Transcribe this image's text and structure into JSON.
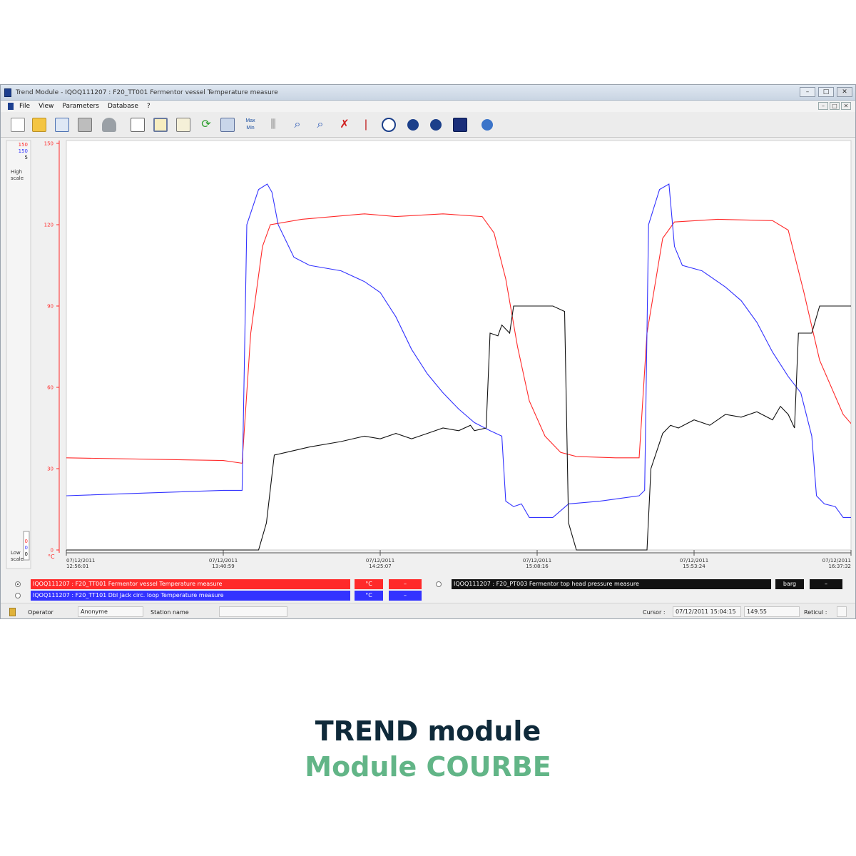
{
  "window": {
    "title": "Trend Module - IQOQ111207 : F20_TT001 Fermentor vessel Temperature measure",
    "min": "–",
    "max": "□",
    "close": "✕"
  },
  "menu": {
    "items": [
      "File",
      "View",
      "Parameters",
      "Database",
      "?"
    ],
    "mdi_min": "–",
    "mdi_max": "□",
    "mdi_close": "✕"
  },
  "toolbar": {
    "max_label": "Max",
    "min_label": "Min",
    "icons": [
      "new-file-icon",
      "open-folder-icon",
      "edit-icon",
      "print-icon",
      "export-icon",
      "report-icon",
      "window-icon",
      "chart-icon",
      "refresh-icon",
      "database-icon",
      "max-min-icon",
      "grid-icon",
      "zoom-in-icon",
      "zoom-out-icon",
      "zoom-reset-icon",
      "cursor-line-icon",
      "clock-icon",
      "previous-icon",
      "next-icon",
      "copy-windows-icon",
      "help-icon"
    ]
  },
  "colors": {
    "series_red": "#ff2a2a",
    "series_blue": "#3333ff",
    "series_black": "#111111",
    "caption_dark": "#0f2a3a",
    "caption_green": "#62b587"
  },
  "scale": {
    "high_values": [
      "150",
      "150",
      "5"
    ],
    "high_label_1": "High",
    "high_label_2": "scale",
    "low_values": [
      "0",
      "0",
      "0"
    ],
    "low_label_1": "Low",
    "low_label_2": "scale",
    "unit": "°C"
  },
  "chart_data": {
    "type": "line",
    "ylim": [
      0,
      150
    ],
    "y_ticks": [
      "150",
      "120",
      "90",
      "60",
      "30",
      "0"
    ],
    "x_ticks": [
      {
        "date": "07/12/2011",
        "time": "12:56:01"
      },
      {
        "date": "07/12/2011",
        "time": "13:40:59"
      },
      {
        "date": "07/12/2011",
        "time": "14:25:07"
      },
      {
        "date": "07/12/2011",
        "time": "15:08:16"
      },
      {
        "date": "07/12/2011",
        "time": "15:53:24"
      },
      {
        "date": "07/12/2011",
        "time": "16:37:32"
      }
    ],
    "x_range": [
      0,
      100
    ],
    "series": [
      {
        "name": "IQOQ111207 : F20_TT001 Fermentor vessel Temperature measure",
        "color": "#ff2a2a",
        "points": [
          [
            0,
            34
          ],
          [
            10,
            33.5
          ],
          [
            20,
            33
          ],
          [
            22.4,
            32
          ],
          [
            23.5,
            80
          ],
          [
            25,
            112
          ],
          [
            26,
            120
          ],
          [
            30,
            122
          ],
          [
            38,
            124
          ],
          [
            42,
            123
          ],
          [
            48,
            124
          ],
          [
            53,
            123
          ],
          [
            54.5,
            117
          ],
          [
            56,
            100
          ],
          [
            57.5,
            75
          ],
          [
            59,
            55
          ],
          [
            61,
            42
          ],
          [
            63,
            36
          ],
          [
            65,
            34.5
          ],
          [
            70,
            34
          ],
          [
            73,
            34
          ],
          [
            74,
            80
          ],
          [
            76,
            115
          ],
          [
            77.5,
            121
          ],
          [
            83,
            122
          ],
          [
            90,
            121.5
          ],
          [
            92,
            118
          ],
          [
            94,
            95
          ],
          [
            96,
            70
          ],
          [
            99,
            50
          ],
          [
            102,
            40
          ],
          [
            104,
            37
          ],
          [
            106,
            36
          ],
          [
            108,
            37
          ],
          [
            111,
            37
          ],
          [
            112,
            36
          ]
        ]
      },
      {
        "name": "IQOQ111207 : F20_TT101 Dbl Jack circ. loop Temperature measure",
        "color": "#3333ff",
        "points": [
          [
            0,
            20
          ],
          [
            10,
            21
          ],
          [
            20,
            22
          ],
          [
            22.4,
            22
          ],
          [
            23,
            120
          ],
          [
            24.5,
            133
          ],
          [
            25.6,
            135
          ],
          [
            26.2,
            132
          ],
          [
            27,
            120
          ],
          [
            29,
            108
          ],
          [
            31,
            105
          ],
          [
            35,
            103
          ],
          [
            38,
            99
          ],
          [
            40,
            95
          ],
          [
            42,
            86
          ],
          [
            44,
            74
          ],
          [
            46,
            65
          ],
          [
            48,
            58
          ],
          [
            50,
            52
          ],
          [
            52,
            47
          ],
          [
            54,
            44
          ],
          [
            55.5,
            42
          ],
          [
            56,
            18
          ],
          [
            57,
            16
          ],
          [
            58,
            17
          ],
          [
            59,
            12
          ],
          [
            62,
            12
          ],
          [
            64,
            17
          ],
          [
            68,
            18
          ],
          [
            73,
            20
          ],
          [
            73.7,
            22
          ],
          [
            74.2,
            120
          ],
          [
            75.6,
            133
          ],
          [
            76.8,
            135
          ],
          [
            77.5,
            112
          ],
          [
            78.5,
            105
          ],
          [
            81,
            103
          ],
          [
            84,
            97
          ],
          [
            86,
            92
          ],
          [
            88,
            84
          ],
          [
            90,
            73
          ],
          [
            92,
            64
          ],
          [
            93.6,
            58
          ],
          [
            95,
            42
          ],
          [
            95.6,
            20
          ],
          [
            96.6,
            17
          ],
          [
            98,
            16
          ],
          [
            99,
            12
          ],
          [
            104,
            12
          ],
          [
            105,
            34
          ],
          [
            106,
            44
          ],
          [
            107,
            35
          ],
          [
            108,
            30
          ],
          [
            109,
            35
          ],
          [
            110,
            40
          ],
          [
            111.5,
            38
          ],
          [
            112,
            36
          ]
        ]
      },
      {
        "name": "IQOQ111207 : F20_PT003 Fermentor top head pressure measure",
        "color": "#111111",
        "points": [
          [
            0,
            0
          ],
          [
            22,
            0
          ],
          [
            24.5,
            0
          ],
          [
            25.5,
            10
          ],
          [
            26.5,
            35
          ],
          [
            28,
            36
          ],
          [
            31,
            38
          ],
          [
            35,
            40
          ],
          [
            38,
            42
          ],
          [
            40,
            41
          ],
          [
            42,
            43
          ],
          [
            44,
            41
          ],
          [
            46,
            43
          ],
          [
            48,
            45
          ],
          [
            50,
            44
          ],
          [
            51.5,
            46
          ],
          [
            52,
            44
          ],
          [
            53.5,
            45
          ],
          [
            54,
            80
          ],
          [
            55,
            79
          ],
          [
            55.5,
            83
          ],
          [
            56.5,
            80
          ],
          [
            57,
            90
          ],
          [
            58,
            90
          ],
          [
            62,
            90
          ],
          [
            63.5,
            88
          ],
          [
            64,
            10
          ],
          [
            65,
            0
          ],
          [
            70,
            0
          ],
          [
            74,
            0
          ],
          [
            74.5,
            30
          ],
          [
            76,
            43
          ],
          [
            77,
            46
          ],
          [
            78,
            45
          ],
          [
            80,
            48
          ],
          [
            82,
            46
          ],
          [
            84,
            50
          ],
          [
            86,
            49
          ],
          [
            88,
            51
          ],
          [
            90,
            48
          ],
          [
            91,
            53
          ],
          [
            92,
            50
          ],
          [
            92.8,
            45
          ],
          [
            93.3,
            80
          ],
          [
            95,
            80
          ],
          [
            96,
            90
          ],
          [
            98,
            90
          ],
          [
            101,
            90
          ],
          [
            102,
            89
          ],
          [
            102.8,
            10
          ],
          [
            104,
            8
          ],
          [
            108,
            8
          ],
          [
            112,
            8
          ]
        ]
      }
    ]
  },
  "legend": {
    "rows": [
      {
        "label": "IQOQ111207 : F20_TT001 Fermentor vessel Temperature measure",
        "unit": "°C",
        "extra": "–",
        "color": "#ff2a2a",
        "selected": true
      },
      {
        "label": "IQOQ111207 : F20_TT101 Dbl Jack circ. loop Temperature measure",
        "unit": "°C",
        "extra": "–",
        "color": "#3333ff",
        "selected": false
      },
      {
        "label": "IQOQ111207 : F20_PT003 Fermentor top head pressure measure",
        "unit": "barg",
        "extra": "–",
        "color": "#111111",
        "selected": false
      }
    ]
  },
  "status": {
    "operator_label": "Operator",
    "operator_value": "Anonyme",
    "station_label": "Station name",
    "station_value": "",
    "cursor_label": "Cursor :",
    "cursor_time": "07/12/2011 15:04:15",
    "cursor_value": "149.55",
    "reticule_label": "Reticul :"
  },
  "caption": {
    "line1": "TREND module",
    "line2": "Module COURBE"
  }
}
